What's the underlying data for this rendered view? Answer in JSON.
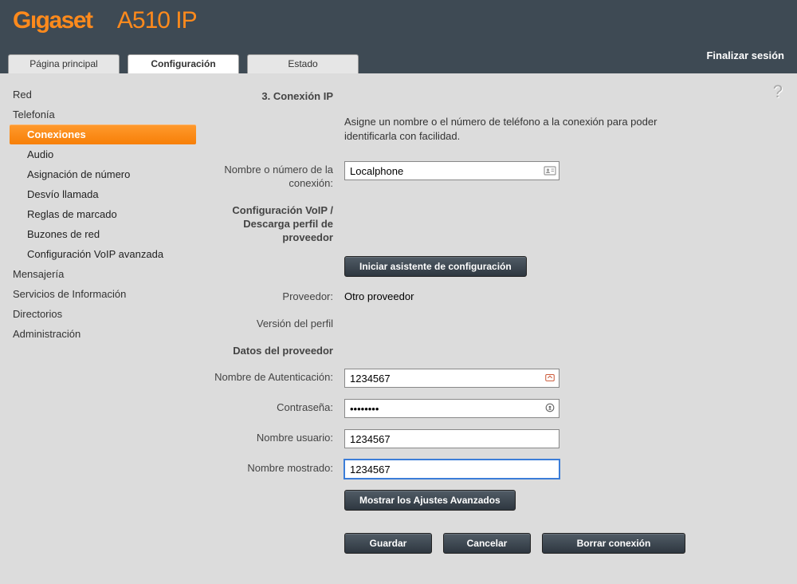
{
  "brand": {
    "name": "Gıgaset",
    "model": "A510 IP"
  },
  "tabs": {
    "home": "Página principal",
    "config": "Configuración",
    "status": "Estado"
  },
  "logout": "Finalizar sesión",
  "help_icon": "?",
  "nav": {
    "red": "Red",
    "telefonia": "Telefonía",
    "conexiones": "Conexiones",
    "audio": "Audio",
    "asignacion": "Asignación de número",
    "desvio": "Desvío llamada",
    "reglas": "Reglas de marcado",
    "buzones": "Buzones de red",
    "voip_avanzada": "Configuración VoIP avanzada",
    "mensajeria": "Mensajería",
    "servicios_info": "Servicios de Información",
    "directorios": "Directorios",
    "administracion": "Administración"
  },
  "form": {
    "section_title": "3. Conexión IP",
    "intro": "Asigne un nombre o el número de teléfono a la conexión para poder identificarla con facilidad.",
    "conn_name_label": "Nombre o número de la conexión:",
    "conn_name_value": "Localphone",
    "voip_download_label": "Configuración VoIP / Descarga perfil de proveedor",
    "start_wizard_btn": "Iniciar asistente de configuración",
    "provider_label": "Proveedor:",
    "provider_value": "Otro proveedor",
    "profile_version_label": "Versión del perfil",
    "provider_data_header": "Datos del proveedor",
    "auth_name_label": "Nombre de Autenticación:",
    "auth_name_value": "1234567",
    "password_label": "Contraseña:",
    "password_value": "••••••••",
    "username_label": "Nombre usuario:",
    "username_value": "1234567",
    "display_name_label": "Nombre mostrado:",
    "display_name_value": "1234567",
    "show_advanced_btn": "Mostrar los Ajustes Avanzados",
    "save_btn": "Guardar",
    "cancel_btn": "Cancelar",
    "delete_conn_btn": "Borrar conexión"
  }
}
